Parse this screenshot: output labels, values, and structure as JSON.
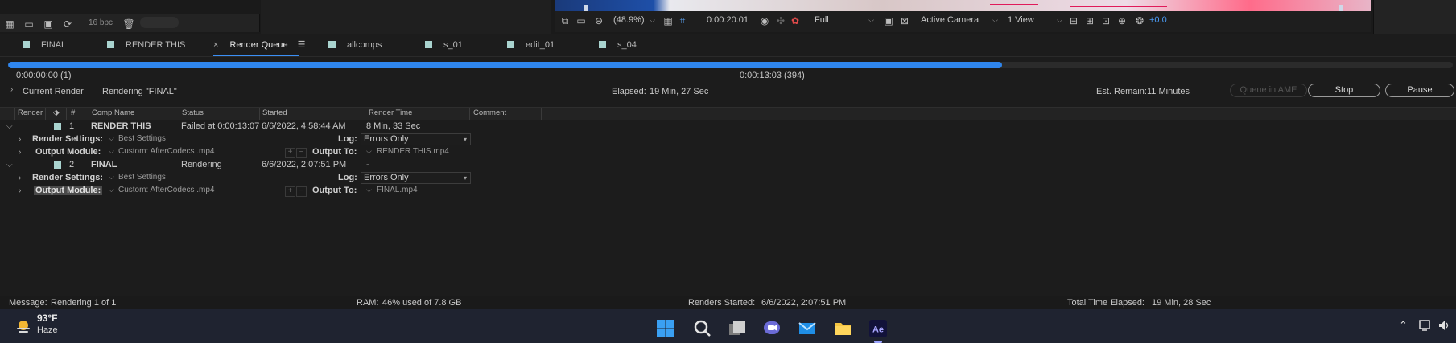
{
  "project_toolbar": {
    "bit_depth": "16 bpc"
  },
  "viewer_toolbar": {
    "magnification": "(48.9%)",
    "timecode": "0:00:20:01",
    "resolution": "Full",
    "camera": "Active Camera",
    "views": "1 View",
    "exposure": "+0.0"
  },
  "tabs": [
    {
      "label": "FINAL"
    },
    {
      "label": "RENDER THIS"
    },
    {
      "label": "Render Queue",
      "active": true
    },
    {
      "label": "allcomps"
    },
    {
      "label": "s_01"
    },
    {
      "label": "edit_01"
    },
    {
      "label": "s_04"
    }
  ],
  "progress": {
    "fraction": 0.688,
    "start": "0:00:00:00 (1)",
    "current": "0:00:13:03 (394)"
  },
  "current_render": {
    "label": "Current Render",
    "status": "Rendering \"FINAL\"",
    "elapsed_label": "Elapsed:",
    "elapsed": "19 Min, 27 Sec",
    "remain_label": "Est. Remain:",
    "remain": "11 Minutes",
    "queue_ame": "Queue in AME",
    "stop": "Stop",
    "pause": "Pause"
  },
  "columns": [
    "Render",
    "#",
    "Comp Name",
    "Status",
    "Started",
    "Render Time",
    "Comment"
  ],
  "items": [
    {
      "num": "1",
      "comp": "RENDER THIS",
      "status": "Failed at 0:00:13:07",
      "started": "6/6/2022, 4:58:44 AM",
      "render_time": "8 Min, 33 Sec",
      "render_settings_label": "Render Settings:",
      "render_settings": "Best Settings",
      "log_label": "Log:",
      "log": "Errors Only",
      "output_module_label": "Output Module:",
      "output_module": "Custom: AfterCodecs .mp4",
      "output_to_label": "Output To:",
      "output_to": "RENDER THIS.mp4"
    },
    {
      "num": "2",
      "comp": "FINAL",
      "status": "Rendering",
      "started": "6/6/2022, 2:07:51 PM",
      "render_time": "-",
      "render_settings_label": "Render Settings:",
      "render_settings": "Best Settings",
      "log_label": "Log:",
      "log": "Errors Only",
      "output_module_label": "Output Module:",
      "output_module": "Custom: AfterCodecs .mp4",
      "output_to_label": "Output To:",
      "output_to": "FINAL.mp4"
    }
  ],
  "status_bar": {
    "message_label": "Message:",
    "message": "Rendering 1 of 1",
    "ram_label": "RAM:",
    "ram": "46% used of 7.8 GB",
    "renders_started_label": "Renders Started:",
    "renders_started": "6/6/2022, 2:07:51 PM",
    "total_elapsed_label": "Total Time Elapsed:",
    "total_elapsed": "19 Min, 28 Sec"
  },
  "taskbar": {
    "temperature": "93°F",
    "condition": "Haze",
    "ae_label": "Ae"
  },
  "colors": {
    "accent": "#2f86ee",
    "label_swatch": "#a9d3cf",
    "background": "#1c1c1c"
  }
}
